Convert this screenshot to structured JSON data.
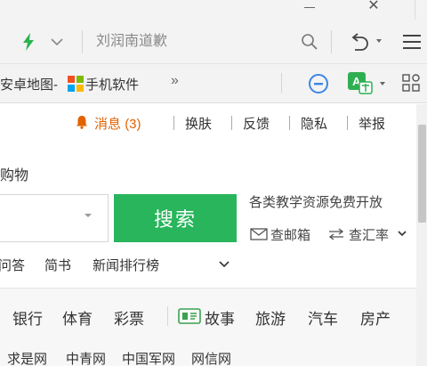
{
  "address_bar": {
    "placeholder": "刘润南道歉"
  },
  "bookmarks": {
    "items": [
      "安卓地图-",
      "手机软件"
    ],
    "more": "»"
  },
  "topline": {
    "message_label": "消息",
    "message_count": "(3)",
    "links": [
      "换肤",
      "反馈",
      "隐私",
      "举报"
    ]
  },
  "search": {
    "category": "购物",
    "button_label": "搜索",
    "slogan": "各类教学资源免费开放",
    "mail_label": "查邮箱",
    "rate_label": "查汇率",
    "sub_links": [
      "问答",
      "简书",
      "新闻排行榜"
    ]
  },
  "nav": {
    "row1": [
      "银行",
      "体育",
      "彩票",
      "故事",
      "旅游",
      "汽车",
      "房产"
    ],
    "row2": [
      "求是网",
      "中青网",
      "中国军网",
      "网信网"
    ]
  },
  "colors": {
    "accent_green": "#28b55c",
    "message_orange": "#e26200",
    "toolbar_bg": "#f3f3f3"
  },
  "icons": {
    "security": "lightning-bolt-icon",
    "search": "magnifier-icon",
    "undo": "undo-icon",
    "menu": "hamburger-icon",
    "ext1": "minus-circle-icon",
    "ext2": "translate-icon",
    "apps": "app-grid-icon"
  }
}
